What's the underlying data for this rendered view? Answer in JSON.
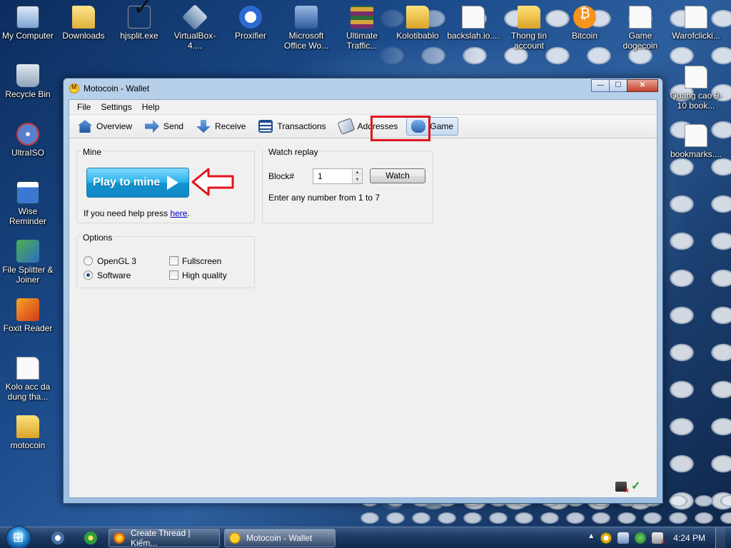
{
  "desktop": {
    "icons": [
      {
        "label": "My Computer",
        "icon": "computer-icon"
      },
      {
        "label": "Downloads",
        "icon": "folder-icon"
      },
      {
        "label": "hjsplit.exe",
        "icon": "check-icon"
      },
      {
        "label": "VirtualBox-4....",
        "icon": "virtualbox-icon"
      },
      {
        "label": "Proxifier",
        "icon": "proxifier-icon"
      },
      {
        "label": "Microsoft Office Wo...",
        "icon": "office-icon"
      },
      {
        "label": "Ultimate Traffic...",
        "icon": "winrar-icon"
      },
      {
        "label": "Kolotibablo",
        "icon": "folder-icon"
      },
      {
        "label": "backslah.io....",
        "icon": "document-icon"
      },
      {
        "label": "Thong tin account",
        "icon": "folder-icon"
      },
      {
        "label": "Bitcoin",
        "icon": "bitcoin-icon"
      },
      {
        "label": "Game dogecoin",
        "icon": "document-icon"
      },
      {
        "label": "Warofclicki...",
        "icon": "document-icon"
      },
      {
        "label": "Recycle Bin",
        "icon": "recycle-bin-icon"
      },
      {
        "label": "Quang cao 9-10 book...",
        "icon": "document-icon"
      },
      {
        "label": "UltraISO",
        "icon": "ultraiso-icon"
      },
      {
        "label": "bookmarks....",
        "icon": "document-icon"
      },
      {
        "label": "Wise Reminder",
        "icon": "calendar-icon"
      },
      {
        "label": "File Splitter & Joiner",
        "icon": "splitter-icon"
      },
      {
        "label": "Foxit Reader",
        "icon": "foxit-icon"
      },
      {
        "label": "Kolo acc da dung tha...",
        "icon": "document-icon"
      },
      {
        "label": "motocoin",
        "icon": "folder-icon"
      }
    ]
  },
  "window": {
    "title": "Motocoin - Wallet",
    "controls": {
      "minimize": "—",
      "maximize": "☐",
      "close": "✕"
    },
    "menu": [
      "File",
      "Settings",
      "Help"
    ],
    "toolbar": [
      {
        "label": "Overview",
        "icon": "home-icon"
      },
      {
        "label": "Send",
        "icon": "send-arrow-icon"
      },
      {
        "label": "Receive",
        "icon": "receive-arrow-icon"
      },
      {
        "label": "Transactions",
        "icon": "list-icon"
      },
      {
        "label": "Addresses",
        "icon": "address-book-icon"
      },
      {
        "label": "Game",
        "icon": "gamepad-icon"
      }
    ],
    "active_tab": "Game",
    "mine": {
      "title": "Mine",
      "play_button": "Play to mine",
      "help_prefix": "If you need help press ",
      "help_link": "here",
      "help_suffix": "."
    },
    "replay": {
      "title": "Watch replay",
      "block_label": "Block#",
      "block_value": "1",
      "watch_button": "Watch",
      "hint": "Enter any number from 1 to 7"
    },
    "options": {
      "title": "Options",
      "opengl_label": "OpenGL 3",
      "software_label": "Software",
      "selected_renderer": "Software",
      "fullscreen_label": "Fullscreen",
      "fullscreen_checked": false,
      "high_quality_label": "High quality",
      "high_quality_checked": false
    },
    "annotation_color": "#e0141e"
  },
  "taskbar": {
    "items": [
      {
        "label": "Create Thread | Kiếm...",
        "icon": "firefox-icon"
      },
      {
        "label": "Motocoin - Wallet",
        "icon": "motocoin-icon"
      }
    ],
    "clock": "4:24 PM"
  }
}
